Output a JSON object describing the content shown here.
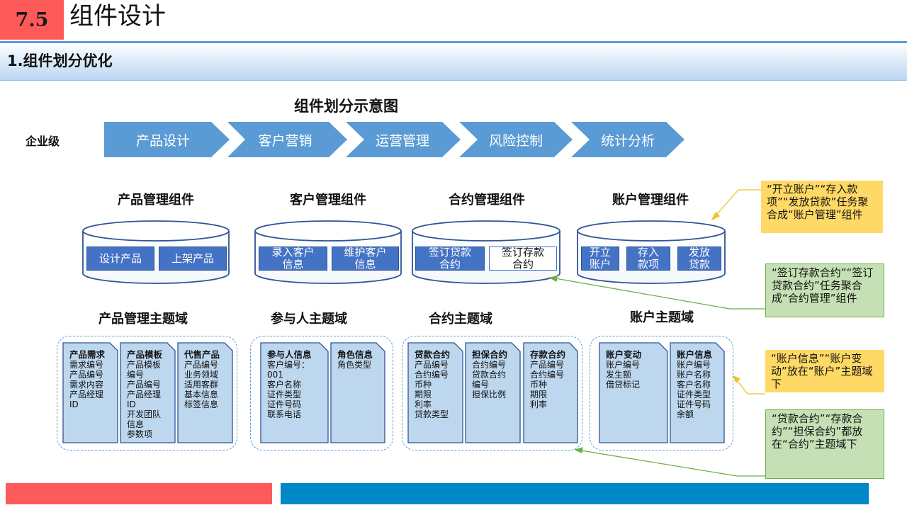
{
  "header": {
    "number": "7.5",
    "title": "组件设计"
  },
  "section": {
    "title": "1.组件划分优化"
  },
  "diagram": {
    "title": "组件划分示意图",
    "level_label": "企业级",
    "stages": [
      "产品设计",
      "客户营销",
      "运营管理",
      "风险控制",
      "统计分析"
    ],
    "components": [
      {
        "title": "产品管理组件",
        "buttons": [
          "设计产品",
          "上架产品"
        ]
      },
      {
        "title": "客户管理组件",
        "buttons": [
          "录入客户信息",
          "维护客户信息"
        ]
      },
      {
        "title": "合约管理组件",
        "buttons": [
          "签订贷款合约",
          "签订存款合约"
        ]
      },
      {
        "title": "账户管理组件",
        "buttons": [
          "开立账户",
          "存入款项",
          "发放贷款"
        ]
      }
    ],
    "domains": [
      {
        "title": "产品管理主题域",
        "docs": [
          {
            "heading": "产品需求",
            "lines": "需求编号\n产品编号\n需求内容\n产品经理\nID"
          },
          {
            "heading": "产品模板",
            "lines": "产品模板\n编号\n产品编号\n产品经理\nID\n开发团队\n信息\n参数项"
          },
          {
            "heading": "代售产品",
            "lines": "产品编号\n业务领域\n适用客群\n基本信息\n标签信息"
          }
        ]
      },
      {
        "title": "参与人主题域",
        "docs": [
          {
            "heading": "参与人信息",
            "lines": "客户编号：\n001\n客户名称\n证件类型\n证件号码\n联系电话"
          },
          {
            "heading": "角色信息",
            "lines": "角色类型"
          }
        ]
      },
      {
        "title": "合约主题域",
        "docs": [
          {
            "heading": "贷款合约",
            "lines": "产品编号\n合约编号\n币种\n期限\n利率\n贷款类型"
          },
          {
            "heading": "担保合约",
            "lines": "合约编号\n贷款合约\n编号\n担保比例"
          },
          {
            "heading": "存款合约",
            "lines": "产品编号\n合约编号\n币种\n期限\n利率"
          }
        ]
      },
      {
        "title": "账户主题域",
        "docs": [
          {
            "heading": "账户变动",
            "lines": "账户编号\n发生额\n借贷标记"
          },
          {
            "heading": "账户信息",
            "lines": "账户编号\n账户名称\n客户名称\n证件类型\n证件号码\n余额"
          }
        ]
      }
    ]
  },
  "notes": [
    "“开立账户”“存入款项”“发放贷款”任务聚合成“账户管理”组件",
    "“签订存款合约”“签订贷款合约”任务聚合成“合约管理”组件",
    "“账户信息”“账户变动”放在“账户”主题域下",
    "“贷款合约”“存款合约”“担保合约”都放在“合约”主题域下"
  ],
  "colors": {
    "accent_red": "#ff5a5a",
    "chevron_blue": "#5b9bd5",
    "button_blue": "#4472c4",
    "note_yellow": "#ffd966",
    "note_green": "#c5e0b4",
    "bar_blue": "#0087c8"
  }
}
